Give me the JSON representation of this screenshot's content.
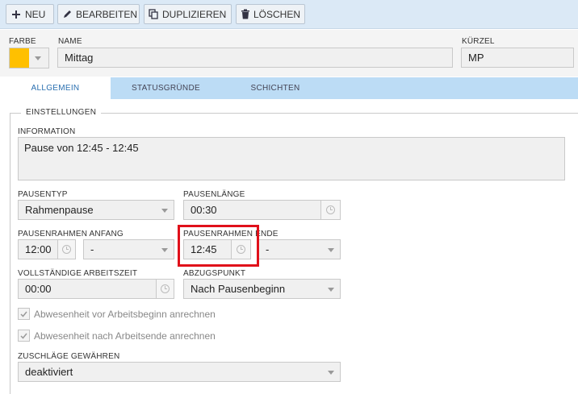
{
  "toolbar": {
    "new_label": "NEU",
    "edit_label": "BEARBEITEN",
    "duplicate_label": "DUPLIZIEREN",
    "delete_label": "LÖSCHEN"
  },
  "header": {
    "color_label": "FARBE",
    "color_value": "#ffc000",
    "name_label": "NAME",
    "name_value": "Mittag",
    "abbr_label": "KÜRZEL",
    "abbr_value": "MP"
  },
  "tabs": [
    {
      "label": "ALLGEMEIN",
      "active": true
    },
    {
      "label": "STATUSGRÜNDE",
      "active": false
    },
    {
      "label": "SCHICHTEN",
      "active": false
    }
  ],
  "settings": {
    "legend": "EINSTELLUNGEN",
    "information_label": "INFORMATION",
    "information_value": "Pause von 12:45 - 12:45",
    "pausentyp_label": "PAUSENTYP",
    "pausentyp_value": "Rahmenpause",
    "pausenlaenge_label": "PAUSENLÄNGE",
    "pausenlaenge_value": "00:30",
    "rahmen_anfang_label": "PAUSENRAHMEN ANFANG",
    "rahmen_anfang_time": "12:00",
    "rahmen_anfang_select": "-",
    "rahmen_ende_label": "PAUSENRAHMEN ENDE",
    "rahmen_ende_time": "12:45",
    "rahmen_ende_select": "-",
    "arbeitszeit_label": "VOLLSTÄNDIGE ARBEITSZEIT",
    "arbeitszeit_value": "00:00",
    "abzugspunkt_label": "ABZUGSPUNKT",
    "abzugspunkt_value": "Nach Pausenbeginn",
    "cb1_label": "Abwesenheit vor Arbeitsbeginn anrechnen",
    "cb1_checked": true,
    "cb2_label": "Abwesenheit nach Arbeitsende anrechnen",
    "cb2_checked": true,
    "zuschlaege_label": "ZUSCHLÄGE GEWÄHREN",
    "zuschlaege_value": "deaktiviert"
  },
  "colors": {
    "highlight": "#e0101a",
    "accent": "#2a6fb0"
  }
}
